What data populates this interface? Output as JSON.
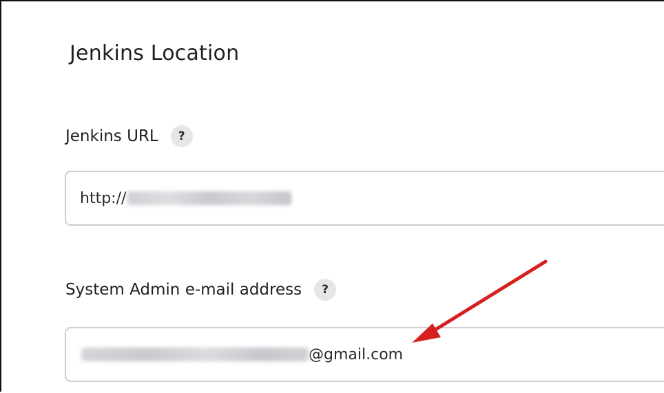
{
  "section": {
    "title": "Jenkins Location"
  },
  "url_field": {
    "label": "Jenkins URL",
    "help_glyph": "?",
    "visible_value_prefix": "http://"
  },
  "email_field": {
    "label": "System Admin e-mail address",
    "help_glyph": "?",
    "visible_value_suffix": "@gmail.com"
  },
  "annotation": {
    "arrow_color": "#d62020",
    "icon": "red-arrow-icon"
  },
  "colors": {
    "help_button_bg": "#e6e6e9",
    "input_border": "#cdcdd2"
  }
}
